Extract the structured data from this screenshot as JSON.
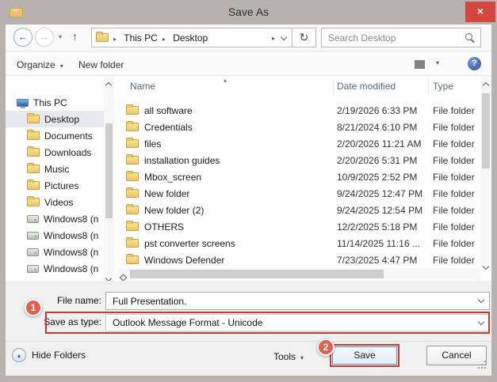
{
  "window": {
    "title": "Save As",
    "close_glyph": "×"
  },
  "address_bar": {
    "back_glyph": "←",
    "forward_glyph": "→",
    "dropdown_glyph": "▾",
    "up_glyph": "↑",
    "refresh_glyph": "↻",
    "breadcrumb": {
      "separator_glyph": "▸",
      "items": [
        "This PC",
        "Desktop"
      ]
    },
    "search_placeholder": "Search Desktop"
  },
  "toolbar": {
    "organize_label": "Organize",
    "organize_arrow": "▾",
    "new_folder_label": "New folder",
    "views_arrow": "▾",
    "help_glyph": "?"
  },
  "sidebar": {
    "items": [
      {
        "label": "This PC",
        "icon": "computer",
        "level": 0
      },
      {
        "label": "Desktop",
        "icon": "folder",
        "level": 1,
        "selected": true
      },
      {
        "label": "Documents",
        "icon": "folder",
        "level": 1
      },
      {
        "label": "Downloads",
        "icon": "folder",
        "level": 1
      },
      {
        "label": "Music",
        "icon": "folder",
        "level": 1
      },
      {
        "label": "Pictures",
        "icon": "folder",
        "level": 1
      },
      {
        "label": "Videos",
        "icon": "folder",
        "level": 1
      },
      {
        "label": "Windows8 (n",
        "icon": "drive",
        "level": 1
      },
      {
        "label": "Windows8 (n",
        "icon": "drive",
        "level": 1
      },
      {
        "label": "Windows8 (n",
        "icon": "drive",
        "level": 1
      },
      {
        "label": "Windows8 (n",
        "icon": "drive",
        "level": 1
      }
    ]
  },
  "file_list": {
    "sort_glyph": "▴",
    "columns": {
      "name": "Name",
      "date": "Date modified",
      "type": "Type"
    },
    "rows": [
      {
        "name": "all software",
        "date": "2/19/2026 6:33 PM",
        "type": "File folder"
      },
      {
        "name": "Credentials",
        "date": "8/21/2024 6:10 PM",
        "type": "File folder"
      },
      {
        "name": "files",
        "date": "2/20/2026 11:21 AM",
        "type": "File folder"
      },
      {
        "name": "installation guides",
        "date": "2/20/2026 5:31 PM",
        "type": "File folder"
      },
      {
        "name": "Mbox_screen",
        "date": "10/9/2025 2:52 PM",
        "type": "File folder"
      },
      {
        "name": "New folder",
        "date": "9/24/2025 12:47 PM",
        "type": "File folder"
      },
      {
        "name": "New folder (2)",
        "date": "9/24/2025 12:54 PM",
        "type": "File folder"
      },
      {
        "name": "OTHERS",
        "date": "12/2/2025 5:18 PM",
        "type": "File folder"
      },
      {
        "name": "pst converter screens",
        "date": "11/14/2025 11:16 ...",
        "type": "File folder"
      },
      {
        "name": "Windows Defender",
        "date": "7/23/2025 4:47 PM",
        "type": "File folder"
      }
    ]
  },
  "fields": {
    "file_name": {
      "label": "File name:",
      "value": "Full Presentation."
    },
    "save_as_type": {
      "label": "Save as type:",
      "value": "Outlook Message Format - Unicode"
    }
  },
  "footer": {
    "hide_folders_label": "Hide Folders",
    "hide_folders_glyph": "▴",
    "tools_label": "Tools",
    "tools_arrow": "▾",
    "save_label": "Save",
    "cancel_label": "Cancel"
  },
  "annotations": {
    "step1": "1",
    "step2": "2"
  },
  "colors": {
    "annotation_red": "#c63a31",
    "badge_fill": "#e0604c",
    "close_red": "#d5473d",
    "titlebar_gray": "#b5b2af",
    "selection": "#e7e9ec"
  }
}
